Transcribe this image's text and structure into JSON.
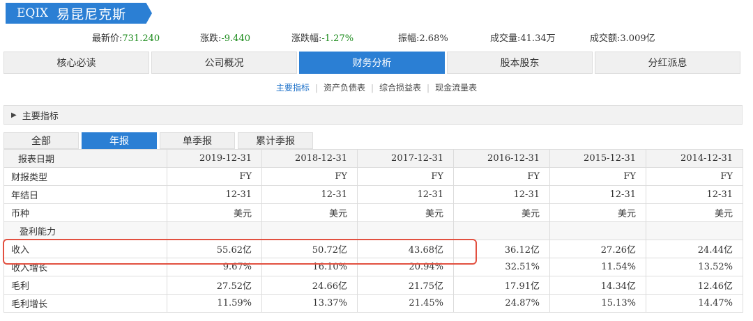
{
  "stock": {
    "code": "EQIX",
    "name": "易昆尼克斯"
  },
  "quote": {
    "latest_price_label": "最新价:",
    "latest_price": "731.240",
    "change_label": "涨跌:",
    "change": "-9.440",
    "change_pct_label": "涨跌幅:",
    "change_pct": "-1.27%",
    "amplitude_label": "振幅:",
    "amplitude": "2.68%",
    "volume_label": "成交量:",
    "volume": "41.34万",
    "turnover_label": "成交额:",
    "turnover": "3.009亿"
  },
  "nav_tabs": [
    "核心必读",
    "公司概况",
    "财务分析",
    "股本股东",
    "分红派息"
  ],
  "subnav": [
    "主要指标",
    "资产负债表",
    "综合损益表",
    "现金流量表"
  ],
  "section_title": "主要指标",
  "report_tabs": [
    "全部",
    "年报",
    "单季报",
    "累计季报"
  ],
  "table": {
    "header_label": "报表日期",
    "dates": [
      "2019-12-31",
      "2018-12-31",
      "2017-12-31",
      "2016-12-31",
      "2015-12-31",
      "2014-12-31"
    ],
    "rows": [
      {
        "label": "财报类型",
        "values": [
          "FY",
          "FY",
          "FY",
          "FY",
          "FY",
          "FY"
        ]
      },
      {
        "label": "年结日",
        "values": [
          "12-31",
          "12-31",
          "12-31",
          "12-31",
          "12-31",
          "12-31"
        ]
      },
      {
        "label": "币种",
        "values": [
          "美元",
          "美元",
          "美元",
          "美元",
          "美元",
          "美元"
        ]
      }
    ],
    "group_label": "盈利能力",
    "profit_rows": [
      {
        "label": "收入",
        "values": [
          "55.62亿",
          "50.72亿",
          "43.68亿",
          "36.12亿",
          "27.26亿",
          "24.44亿"
        ]
      },
      {
        "label": "收入增长",
        "values": [
          "9.67%",
          "16.10%",
          "20.94%",
          "32.51%",
          "11.54%",
          "13.52%"
        ]
      },
      {
        "label": "毛利",
        "values": [
          "27.52亿",
          "24.66亿",
          "21.75亿",
          "17.91亿",
          "14.34亿",
          "12.46亿"
        ]
      },
      {
        "label": "毛利增长",
        "values": [
          "11.59%",
          "13.37%",
          "21.45%",
          "24.87%",
          "15.13%",
          "14.47%"
        ]
      }
    ]
  },
  "colors": {
    "accent": "#2b7fd4",
    "positive_text": "#1a8a1a",
    "highlight": "#e25040"
  }
}
